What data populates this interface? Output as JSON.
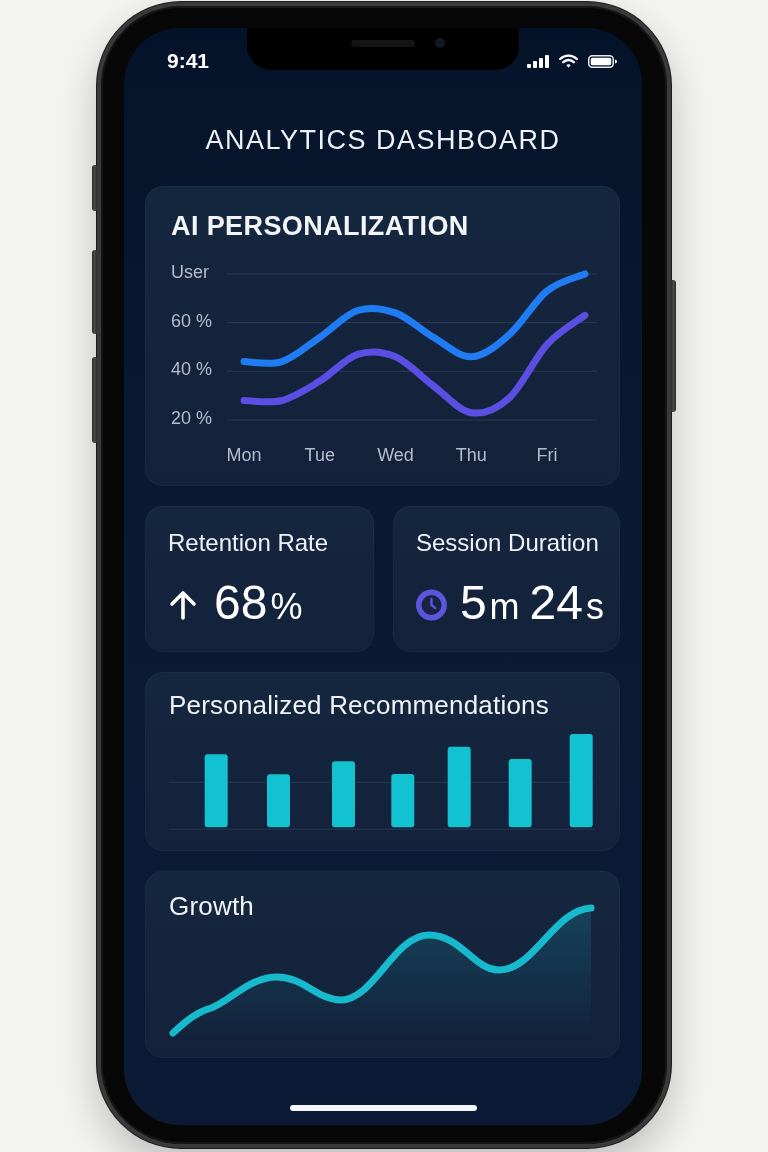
{
  "status_bar": {
    "time": "9:41"
  },
  "title": "ANALYTICS DASHBOARD",
  "personalization": {
    "title": "AI PERSONALIZATION",
    "chart_data": {
      "type": "line",
      "categories": [
        "Mon",
        null,
        "Tue",
        null,
        "Wed",
        null,
        "Thu",
        null,
        "Fri",
        null
      ],
      "series": [
        {
          "color": "#1f7cf2",
          "values": [
            44,
            44,
            54,
            65,
            64,
            54,
            46,
            55,
            73,
            80
          ]
        },
        {
          "color": "#5a4fe2",
          "values": [
            28,
            28,
            36,
            47,
            46,
            34,
            23,
            29,
            51,
            63
          ]
        }
      ],
      "ylim": [
        20,
        80
      ],
      "yticks": [
        {
          "value": 20,
          "label": "20 %"
        },
        {
          "value": 40,
          "label": "40 %"
        },
        {
          "value": 60,
          "label": "60 %"
        },
        {
          "value": 80,
          "label": "User"
        }
      ],
      "grid": true
    }
  },
  "stats": [
    {
      "kind": "trend",
      "label": "Retention Rate",
      "value": "68%"
    },
    {
      "kind": "timer",
      "label": "Session Duration",
      "value": "5m 24s"
    }
  ],
  "recommendations": {
    "title": "Personalized Recommendations"
  },
  "growth": {
    "title": "Growth"
  }
}
